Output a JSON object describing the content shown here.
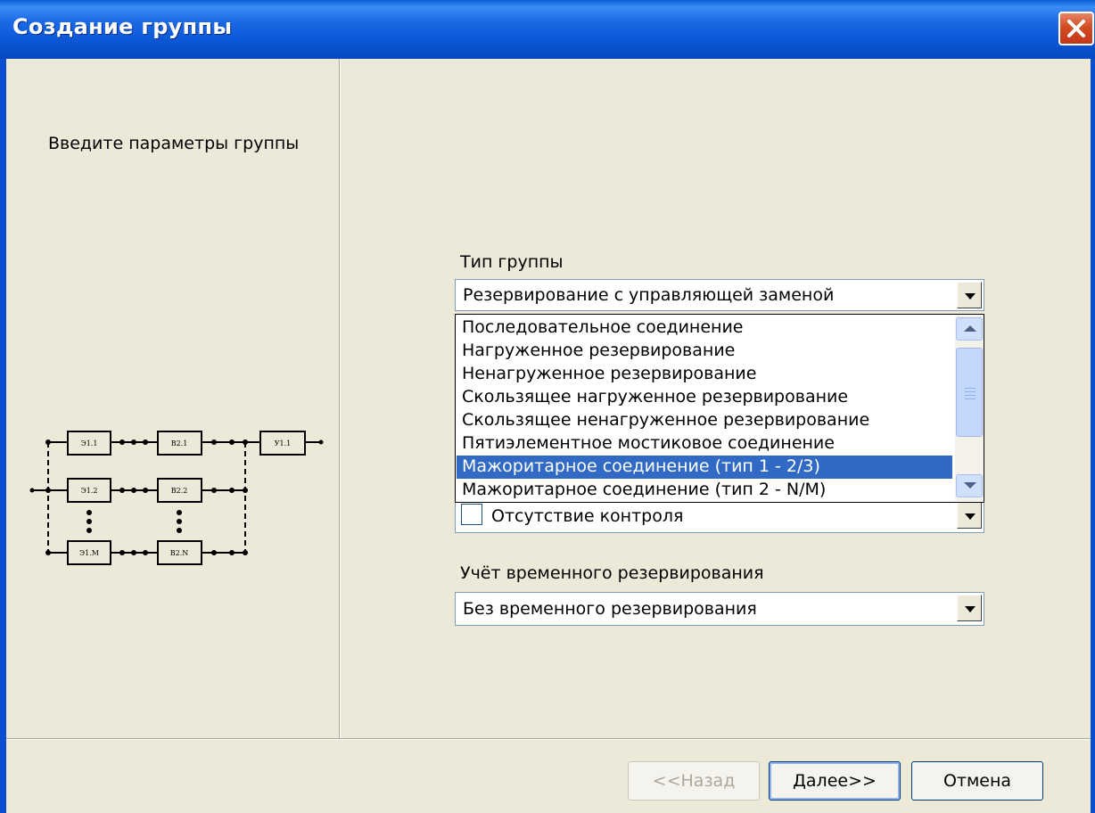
{
  "window": {
    "title": "Создание группы"
  },
  "left_panel": {
    "intro": "Введите параметры группы",
    "schema_labels": [
      "Э1.1",
      "В2.1",
      "У1.1",
      "Э1.2",
      "В2.2",
      "Э1.М",
      "В2.N"
    ]
  },
  "group_type": {
    "label": "Тип группы",
    "selected": "Резервирование с управляющей заменой",
    "options": [
      "Последовательное соединение",
      "Нагруженное резервирование",
      "Ненагруженное резервирование",
      "Скользящее нагруженное резервирование",
      "Скользящее ненагруженное резервирование",
      "Пятиэлементное мостиковое соединение",
      "Мажоритарное соединение (тип 1 - 2/3)",
      "Мажоритарное соединение (тип 2 - N/M)"
    ],
    "highlighted": "Мажоритарное соединение (тип 1 - 2/3)"
  },
  "control": {
    "selected": "Отсутствие контроля"
  },
  "time_reserve": {
    "label": "Учёт временного резервирования",
    "selected": "Без временного резервирования"
  },
  "buttons": {
    "back": "<<Назад",
    "next": "Далее>>",
    "cancel": "Отмена"
  },
  "colors": {
    "title_bar": "#0a56d6",
    "selection": "#316ac5",
    "dialog_bg": "#ece9d8"
  }
}
